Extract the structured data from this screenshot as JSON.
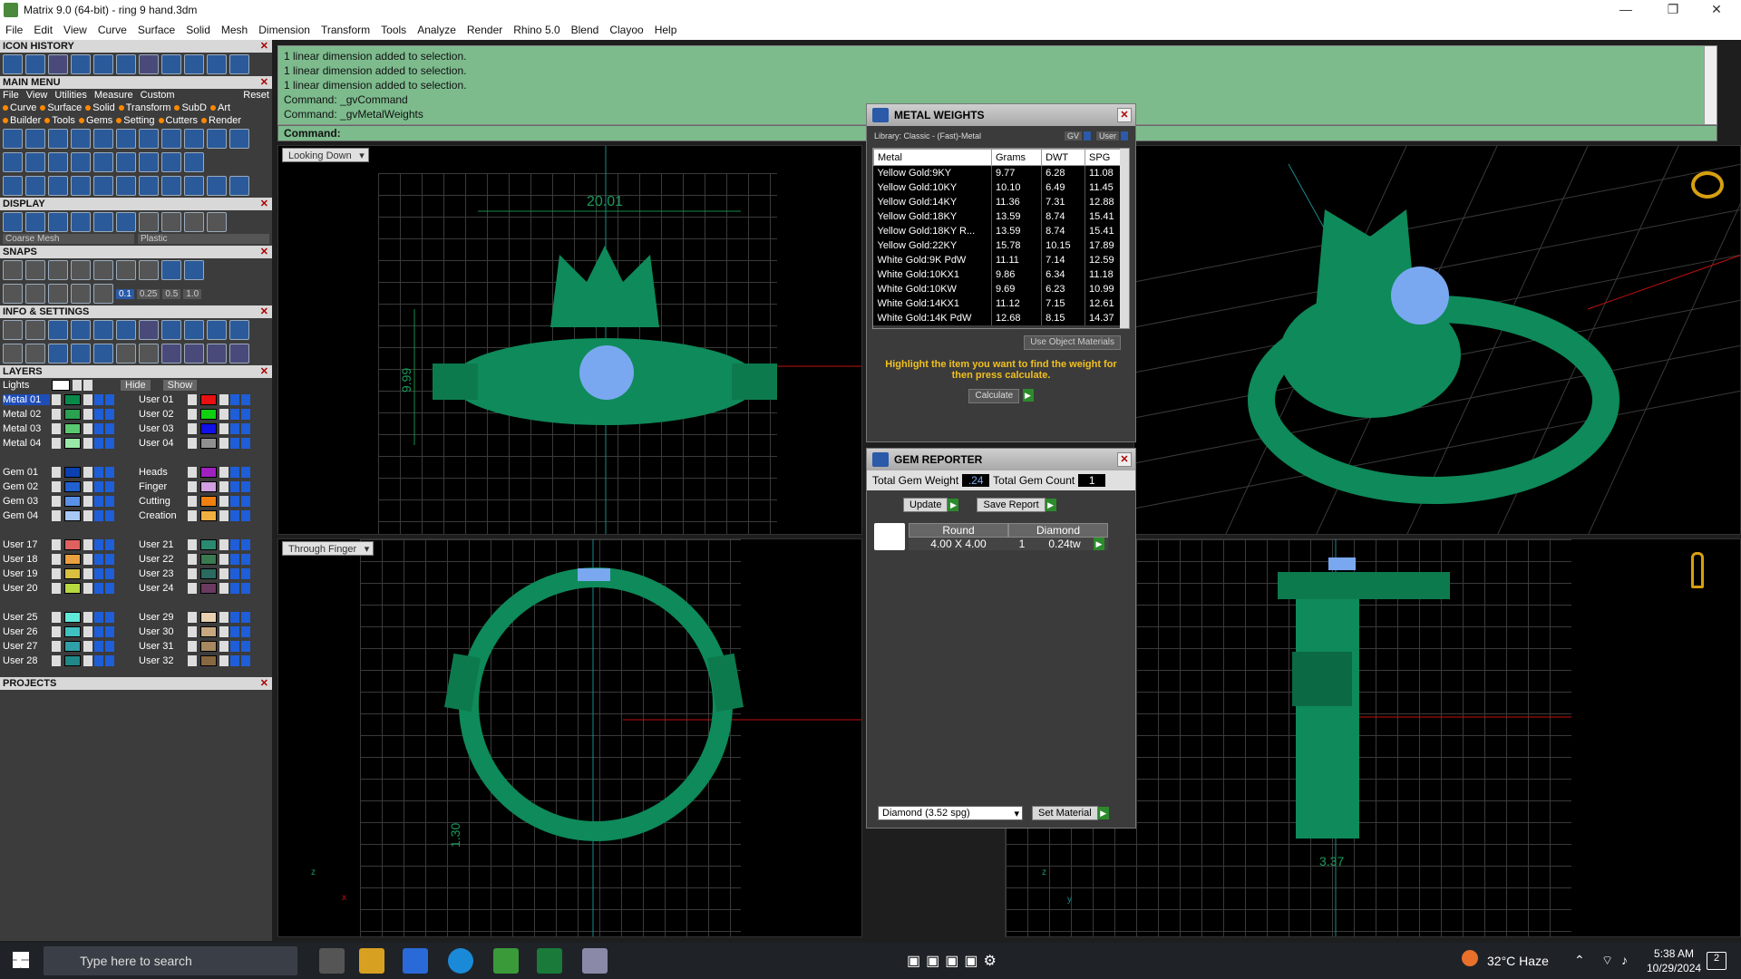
{
  "window": {
    "title": "Matrix 9.0 (64-bit) - ring 9 hand.3dm",
    "minimize": "—",
    "maximize": "❐",
    "close": "✕"
  },
  "menu": [
    "File",
    "Edit",
    "View",
    "Curve",
    "Surface",
    "Solid",
    "Mesh",
    "Dimension",
    "Transform",
    "Tools",
    "Analyze",
    "Render",
    "Rhino 5.0",
    "Blend",
    "Clayoo",
    "Help"
  ],
  "left": {
    "icon_history": "ICON HISTORY",
    "main_menu": "MAIN MENU",
    "mm_top": [
      "File",
      "View",
      "Utilities",
      "Measure",
      "Custom"
    ],
    "mm_reset": "Reset",
    "mm_row1": [
      "Curve",
      "Surface",
      "Solid",
      "Transform",
      "SubD",
      "Art"
    ],
    "mm_row2": [
      "Builder",
      "Tools",
      "Gems",
      "Setting",
      "Cutters",
      "Render"
    ],
    "display": "DISPLAY",
    "display_mesh": "Coarse Mesh",
    "display_mat": "Plastic",
    "snaps": "SNAPS",
    "snap_vals": [
      "0.1",
      "0.25",
      "0.5",
      "1.0"
    ],
    "info": "INFO & SETTINGS",
    "layers": "LAYERS",
    "lights": "Lights",
    "hide": "Hide",
    "show": "Show",
    "projects": "PROJECTS",
    "layers_left": [
      {
        "name": "Metal 01",
        "color": "#0a8a4a",
        "sel": true
      },
      {
        "name": "Metal 02",
        "color": "#2aa050"
      },
      {
        "name": "Metal 03",
        "color": "#5ac870"
      },
      {
        "name": "Metal 04",
        "color": "#9ae8a8"
      },
      {
        "name": "Gem 01",
        "color": "#0a40b0"
      },
      {
        "name": "Gem 02",
        "color": "#2060d0"
      },
      {
        "name": "Gem 03",
        "color": "#5a90e8"
      },
      {
        "name": "Gem 04",
        "color": "#a8c8f8"
      },
      {
        "name": "User 17",
        "color": "#e06060"
      },
      {
        "name": "User 18",
        "color": "#e8a040"
      },
      {
        "name": "User 19",
        "color": "#d8c040"
      },
      {
        "name": "User 20",
        "color": "#b8d840"
      },
      {
        "name": "User 25",
        "color": "#60e8d8"
      },
      {
        "name": "User 26",
        "color": "#40c0c0"
      },
      {
        "name": "User 27",
        "color": "#30a0a8"
      },
      {
        "name": "User 28",
        "color": "#208888"
      }
    ],
    "layers_right": [
      {
        "name": "User 01",
        "color": "#e81010"
      },
      {
        "name": "User 02",
        "color": "#10d010"
      },
      {
        "name": "User 03",
        "color": "#1010e8"
      },
      {
        "name": "User 04",
        "color": "#909090"
      },
      {
        "name": "Heads",
        "color": "#a020c0"
      },
      {
        "name": "Finger",
        "color": "#d0a0e0"
      },
      {
        "name": "Cutting",
        "color": "#f08010"
      },
      {
        "name": "Creation",
        "color": "#f0b040"
      },
      {
        "name": "User 21",
        "color": "#2a8a70"
      },
      {
        "name": "User 22",
        "color": "#3a7a50"
      },
      {
        "name": "User 23",
        "color": "#2a6a60"
      },
      {
        "name": "User 24",
        "color": "#6a3a60"
      },
      {
        "name": "User 29",
        "color": "#e8d0b0"
      },
      {
        "name": "User 30",
        "color": "#c8a880"
      },
      {
        "name": "User 31",
        "color": "#a88860"
      },
      {
        "name": "User 32",
        "color": "#886840"
      }
    ]
  },
  "command": {
    "history": [
      "1 linear dimension added to selection.",
      "1 linear dimension added to selection.",
      "1 linear dimension added to selection.",
      "Command: _gvCommand",
      "Command: _gvMetalWeights"
    ],
    "prompt": "Command:"
  },
  "viewports": {
    "top_left_label": "Looking Down",
    "bottom_left_label": "Through Finger",
    "dim_width": "20.01",
    "dim_height": "9.99",
    "dim_band": "1.30",
    "dim_side": "3.37"
  },
  "metal_weights": {
    "title": "METAL WEIGHTS",
    "library": "Library: Classic - (Fast)-Metal",
    "gv": "GV",
    "user": "User",
    "headers": [
      "Metal",
      "Grams",
      "DWT",
      "SPG"
    ],
    "rows": [
      [
        "Yellow Gold:9KY",
        "9.77",
        "6.28",
        "11.08"
      ],
      [
        "Yellow Gold:10KY",
        "10.10",
        "6.49",
        "11.45"
      ],
      [
        "Yellow Gold:14KY",
        "11.36",
        "7.31",
        "12.88"
      ],
      [
        "Yellow Gold:18KY",
        "13.59",
        "8.74",
        "15.41"
      ],
      [
        "Yellow Gold:18KY R...",
        "13.59",
        "8.74",
        "15.41"
      ],
      [
        "Yellow Gold:22KY",
        "15.78",
        "10.15",
        "17.89"
      ],
      [
        "White Gold:9K PdW",
        "11.11",
        "7.14",
        "12.59"
      ],
      [
        "White Gold:10KX1",
        "9.86",
        "6.34",
        "11.18"
      ],
      [
        "White Gold:10KW",
        "9.69",
        "6.23",
        "10.99"
      ],
      [
        "White Gold:14KX1",
        "11.12",
        "7.15",
        "12.61"
      ],
      [
        "White Gold:14K PdW",
        "12.68",
        "8.15",
        "14.37"
      ]
    ],
    "use_obj": "Use Object Materials",
    "hint": "Highlight the item you want to find the weight for then press calculate.",
    "calculate": "Calculate"
  },
  "gem_reporter": {
    "title": "GEM REPORTER",
    "total_weight_label": "Total Gem Weight",
    "total_weight": ".24",
    "total_count_label": "Total Gem Count",
    "total_count": "1",
    "update": "Update",
    "save_report": "Save Report",
    "col_shape": "Round",
    "col_mat": "Diamond",
    "size": "4.00 X 4.00",
    "qty": "1",
    "weight": "0.24tw",
    "material_select": "Diamond   (3.52 spg)",
    "set_material": "Set Material"
  },
  "taskbar": {
    "search": "Type here to search",
    "weather": "32°C  Haze",
    "time": "5:38 AM",
    "date": "10/29/2024",
    "notif": "2"
  },
  "colors": {
    "metal": "#0f8a5a",
    "gem": "#7aa8f0",
    "command_bg": "#7dbb8d"
  }
}
